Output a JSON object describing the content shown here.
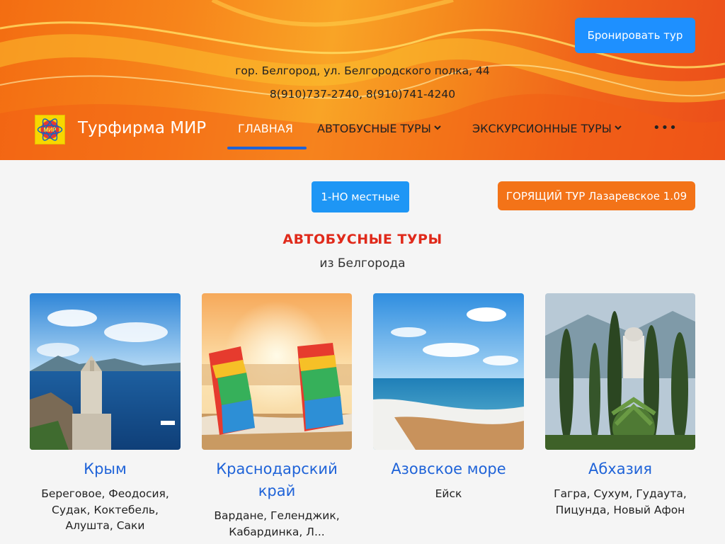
{
  "header": {
    "book_button": "Бронировать тур",
    "address": "гор. Белгород, ул. Белгородского полка, 44",
    "phones": "8(910)737-2740, 8(910)741-4240",
    "brand": "Турфирма МИР",
    "logo_text": "МИР",
    "nav": {
      "home": "ГЛАВНАЯ",
      "bus_tours": "АВТОБУСНЫЕ ТУРЫ",
      "excursion_tours": "ЭКСКУРСИОННЫЕ ТУРЫ",
      "more": "•••"
    }
  },
  "buttons": {
    "one_day": "1-НО местные",
    "hot_tour": "ГОРЯЩИЙ ТУР Лазаревское 1.09"
  },
  "section": {
    "title": "АВТОБУСНЫЕ ТУРЫ",
    "subtitle": "из Белгорода"
  },
  "cards": [
    {
      "title": "Крым",
      "desc": "Береговое, Феодосия, Судак, Коктебель, Алушта, Саки"
    },
    {
      "title": "Краснодарский край",
      "desc": "Вардане, Геленджик, Кабардинка, Л..."
    },
    {
      "title": "Азовское море",
      "desc": "Ейск"
    },
    {
      "title": "Абхазия",
      "desc": "Гагра, Сухум, Гудаута, Пицунда, Новый Афон"
    }
  ],
  "colors": {
    "accent_blue": "#1e90ff",
    "nav_active": "#1f63d8",
    "hot_orange": "#f37318",
    "title_red": "#e02a1b"
  }
}
